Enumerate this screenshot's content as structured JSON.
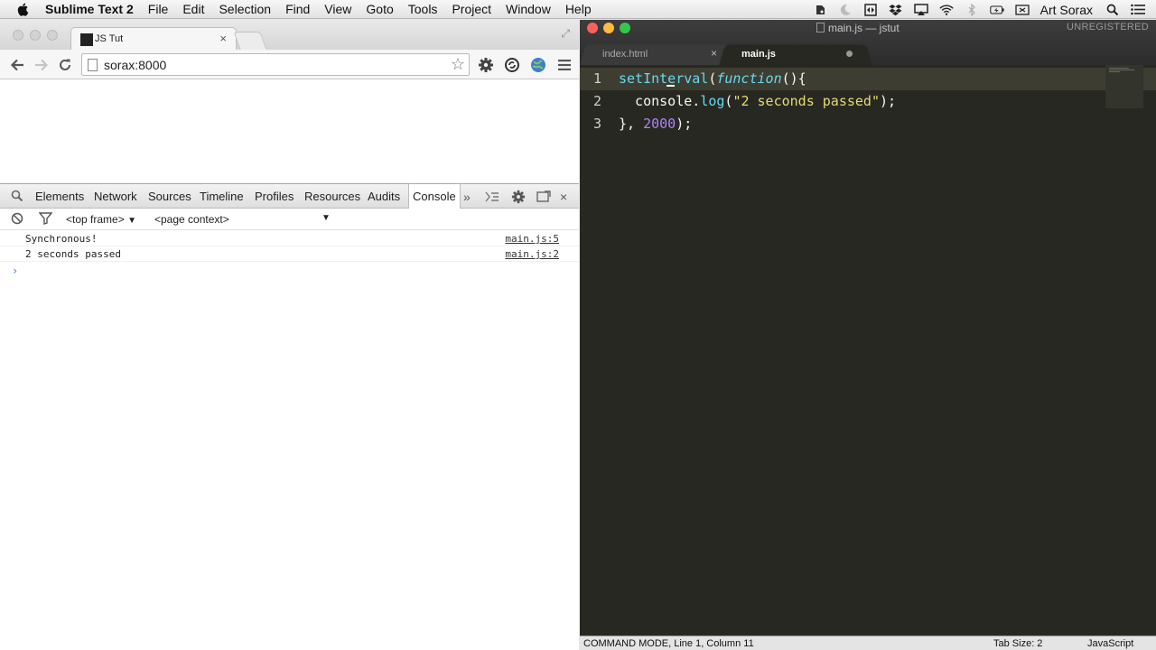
{
  "menubar": {
    "app_name": "Sublime Text 2",
    "items": [
      "File",
      "Edit",
      "Selection",
      "Find",
      "View",
      "Goto",
      "Tools",
      "Project",
      "Window",
      "Help"
    ],
    "user": "Art Sorax",
    "tray_icons": [
      "evernote-icon",
      "moon-icon",
      "resize-icon",
      "dropbox-icon",
      "airplay-icon",
      "wifi-icon",
      "bluetooth-icon",
      "battery-icon",
      "keyboard-icon"
    ]
  },
  "chrome": {
    "tab_title": "JS Tut",
    "url": "sorax:8000",
    "devtools": {
      "tabs": [
        "Elements",
        "Network",
        "Sources",
        "Timeline",
        "Profiles",
        "Resources",
        "Audits",
        "Console"
      ],
      "active_tab": "Console",
      "more": "»",
      "frame": "<top frame>",
      "context": "<page context>",
      "console": [
        {
          "message": "Synchronous!",
          "source": "main.js:5"
        },
        {
          "message": "2 seconds passed",
          "source": "main.js:2"
        }
      ],
      "prompt": "›"
    }
  },
  "sublime": {
    "window_title": "main.js — jstut",
    "unregistered": "UNREGISTERED",
    "tabs": [
      {
        "label": "index.html",
        "close": "×"
      },
      {
        "label": "main.js"
      }
    ],
    "code": {
      "l1": {
        "num": "1",
        "a": "setInterval",
        "b": "(",
        "c": "function",
        "d": "(){"
      },
      "l2": {
        "num": "2",
        "a": "  console.",
        "b": "log",
        "c": "(",
        "d": "\"2 seconds passed\"",
        "e": ");"
      },
      "l3": {
        "num": "3",
        "a": "}, ",
        "b": "2000",
        "c": ");"
      }
    },
    "status": {
      "mode": "COMMAND MODE, Line 1, Column 11",
      "tab_size": "Tab Size: 2",
      "syntax": "JavaScript"
    }
  },
  "colors": {
    "editor_bg": "#272822",
    "keyword": "#66d9ef",
    "string": "#e6db74",
    "number": "#ae81ff"
  }
}
